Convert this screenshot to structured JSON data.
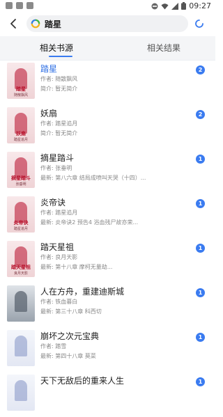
{
  "status_bar": {
    "time": "09:27",
    "icons": [
      "notification-icon",
      "notification-icon",
      "notification-icon",
      "dnd-icon",
      "wifi-icon",
      "signal-icon",
      "battery-icon"
    ]
  },
  "search": {
    "query": "踏星"
  },
  "tabs": [
    {
      "label": "相关书源",
      "active": true
    },
    {
      "label": "相关结果",
      "active": false
    }
  ],
  "colors": {
    "accent": "#3a7bf0",
    "highlight_title": "#2f6fe4"
  },
  "books": [
    {
      "title": "踏星",
      "author": "作者: 随散飘风",
      "latest": "简介: 暂无简介",
      "count": "2",
      "cover_title": "踏星",
      "cover_sub": "随散飘风",
      "cover": "pink",
      "highlight": true
    },
    {
      "title": "妖扇",
      "author": "作者: 踏星追月",
      "latest": "简介: 暂无简介",
      "count": "2",
      "cover_title": "妖扇",
      "cover_sub": "踏星追月",
      "cover": "pink",
      "highlight": false
    },
    {
      "title": "摘星踏斗",
      "author": "作者: 张垂明",
      "latest": "最新: 第八六章 结局成喷叫天哭（十四）...",
      "count": "1",
      "cover_title": "摘星踏斗",
      "cover_sub": "张垂明",
      "cover": "pink",
      "highlight": false
    },
    {
      "title": "炎帝诀",
      "author": "作者: 踏星追月",
      "latest": "最新: 炎帝诀2 预告4 浴血残尸故亦荣...",
      "count": "1",
      "cover_title": "炎帝诀",
      "cover_sub": "踏星追月",
      "cover": "pink",
      "highlight": false
    },
    {
      "title": "踏天星祖",
      "author": "作者: 良月天影",
      "latest": "最新: 第十八章 摩柯无量劫...",
      "count": "1",
      "cover_title": "踏天星祖",
      "cover_sub": "良月天影",
      "cover": "pink",
      "highlight": false
    },
    {
      "title": "人在方舟，重建迪斯城",
      "author": "作者: 铁血暮白",
      "latest": "最新: 第三十八章 科西切",
      "count": "1",
      "cover_title": "",
      "cover_sub": "",
      "cover": "gray",
      "highlight": false
    },
    {
      "title": "崩坏之次元宝典",
      "author": "作者: 踏雪",
      "latest": "最新: 第四十八章 莫菜",
      "count": "1",
      "cover_title": "",
      "cover_sub": "",
      "cover": "white",
      "highlight": false
    },
    {
      "title": "天下无敌后的重来人生",
      "author": "",
      "latest": "",
      "count": "1",
      "cover_title": "",
      "cover_sub": "",
      "cover": "white",
      "highlight": false
    }
  ]
}
